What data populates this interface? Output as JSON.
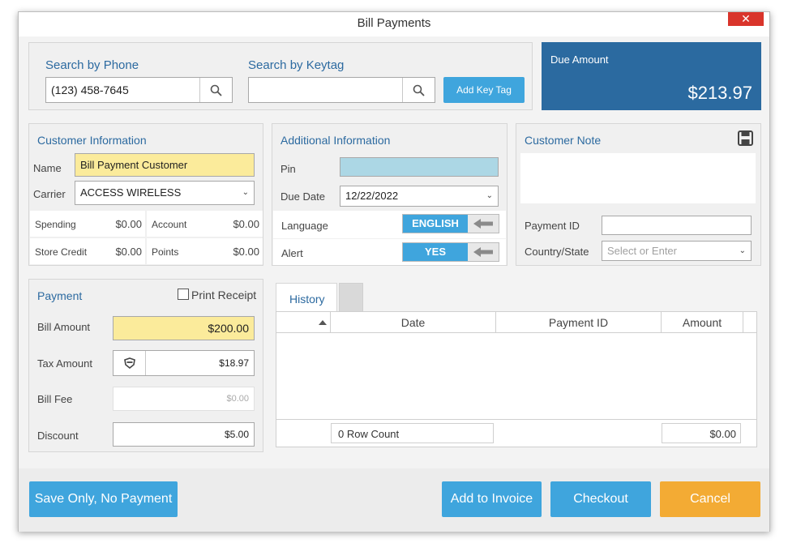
{
  "window": {
    "title": "Bill Payments",
    "close_label": "✕"
  },
  "search": {
    "phone_label": "Search by Phone",
    "phone_value": "(123) 458-7645",
    "keytag_label": "Search by Keytag",
    "keytag_value": "",
    "add_key_tag_label": "Add Key Tag"
  },
  "due": {
    "label": "Due Amount",
    "amount": "$213.97"
  },
  "customer_info": {
    "title": "Customer Information",
    "name_label": "Name",
    "name_value": "Bill Payment Customer",
    "carrier_label": "Carrier",
    "carrier_value": "ACCESS WIRELESS",
    "spending_label": "Spending",
    "spending_value": "$0.00",
    "account_label": "Account",
    "account_value": "$0.00",
    "store_credit_label": "Store Credit",
    "store_credit_value": "$0.00",
    "points_label": "Points",
    "points_value": "$0.00"
  },
  "additional_info": {
    "title": "Additional Information",
    "pin_label": "Pin",
    "pin_value": "",
    "due_date_label": "Due Date",
    "due_date_value": "12/22/2022",
    "language_label": "Language",
    "language_value": "ENGLISH",
    "alert_label": "Alert",
    "alert_value": "YES"
  },
  "customer_note": {
    "title": "Customer Note",
    "note_text": "",
    "payment_id_label": "Payment ID",
    "payment_id_value": "",
    "country_state_label": "Country/State",
    "country_state_placeholder": "Select or Enter"
  },
  "payment": {
    "title": "Payment",
    "print_receipt_label": "Print Receipt",
    "print_receipt_checked": false,
    "bill_amount_label": "Bill Amount",
    "bill_amount_value": "$200.00",
    "tax_amount_label": "Tax Amount",
    "tax_amount_value": "$18.97",
    "bill_fee_label": "Bill Fee",
    "bill_fee_value": "$0.00",
    "discount_label": "Discount",
    "discount_value": "$5.00"
  },
  "history": {
    "tab_label": "History",
    "columns": [
      "Date",
      "Payment ID",
      "Amount"
    ],
    "rows": [],
    "row_count_text": "0 Row Count",
    "total_amount": "$0.00"
  },
  "footer": {
    "save_only_label": "Save Only, No Payment",
    "add_to_invoice_label": "Add to Invoice",
    "checkout_label": "Checkout",
    "cancel_label": "Cancel"
  },
  "colors": {
    "accent": "#3fa5dd",
    "due_bg": "#2b6aa0",
    "cancel": "#f3ab34",
    "highlight": "#fbeb9b",
    "close": "#d9342b"
  }
}
